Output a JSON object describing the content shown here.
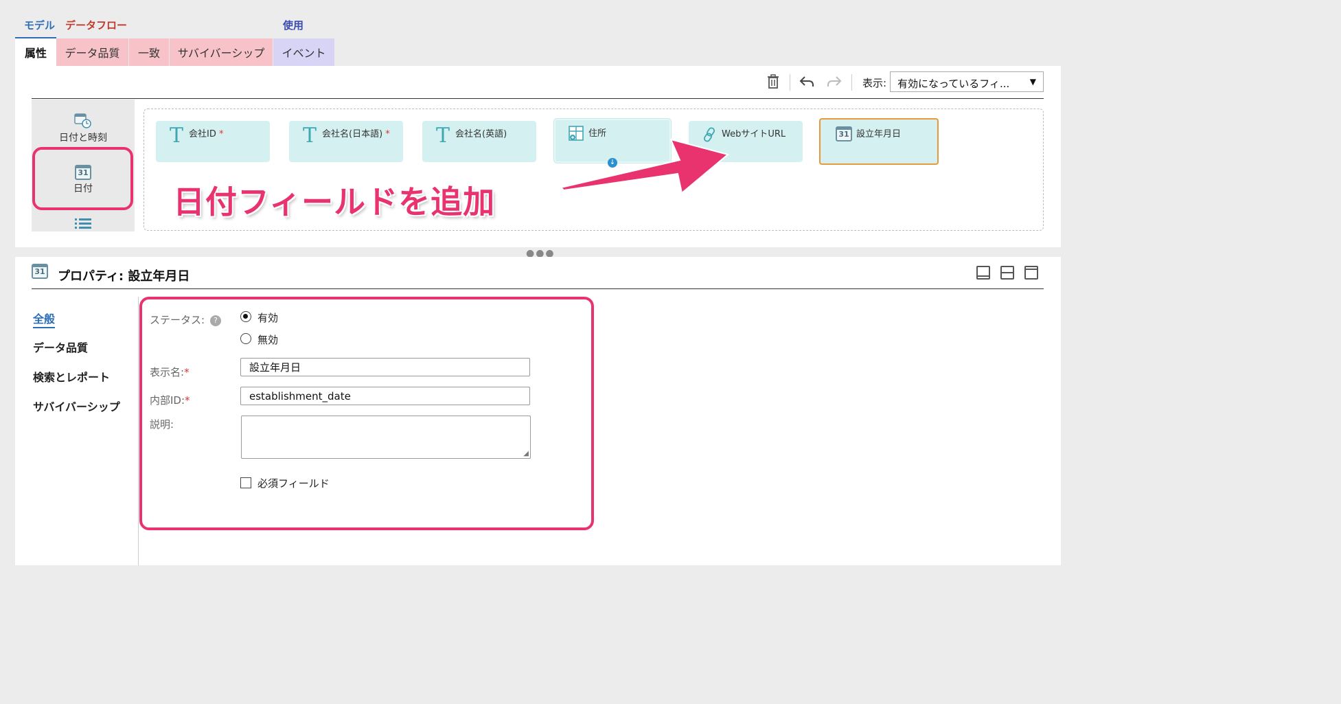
{
  "categories": {
    "model": "モデル",
    "dataflow": "データフロー",
    "usage": "使用"
  },
  "tabs": [
    {
      "label": "属性"
    },
    {
      "label": "データ品質"
    },
    {
      "label": "一致"
    },
    {
      "label": "サバイバーシップ"
    },
    {
      "label": "イベント"
    }
  ],
  "toolbar": {
    "display_label": "表示:",
    "display_value": "有効になっているフィ...",
    "icons": [
      "trash-icon",
      "undo-icon",
      "redo-icon",
      "caret-down-icon"
    ]
  },
  "palette": {
    "items": [
      {
        "label": "日付と時刻",
        "icon": "datetime-icon"
      },
      {
        "label": "日付",
        "icon": "calendar-icon",
        "icon_text": "31"
      }
    ]
  },
  "fields": [
    {
      "label": "会社ID",
      "required": "*",
      "icon": "text-icon",
      "icon_text": "T"
    },
    {
      "label": "会社名(日本語)",
      "required": "*",
      "icon": "text-icon",
      "icon_text": "T"
    },
    {
      "label": "会社名(英語)",
      "required": "",
      "icon": "text-icon",
      "icon_text": "T"
    },
    {
      "label": "住所",
      "required": "",
      "icon": "address-icon"
    },
    {
      "label": "WebサイトURL",
      "required": "",
      "icon": "link-icon"
    },
    {
      "label": "設立年月日",
      "required": "",
      "icon": "calendar-icon",
      "icon_text": "31"
    }
  ],
  "annotation": {
    "text": "日付フィールドを追加",
    "color": "#e8336f"
  },
  "properties": {
    "title": "プロパティ: 設立年月日",
    "icon_text": "31",
    "nav": [
      "全般",
      "データ品質",
      "検索とレポート",
      "サバイバーシップ"
    ],
    "status_label": "ステータス:",
    "help": "?",
    "status_options": [
      "有効",
      "無効"
    ],
    "status_selected": "有効",
    "display_name_label": "表示名:",
    "display_name_value": "設立年月日",
    "internal_id_label": "内部ID:",
    "internal_id_value": "establishment_date",
    "description_label": "説明:",
    "description_value": "",
    "required_field_label": "必須フィールド",
    "required_mark": "*"
  },
  "colors": {
    "accent": "#2c6db5",
    "highlight": "#e8336f",
    "card": "#d5f0f0",
    "selected_border": "#e79a3b"
  }
}
